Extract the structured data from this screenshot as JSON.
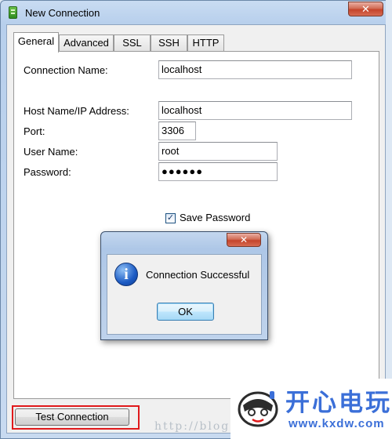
{
  "window": {
    "title": "New Connection",
    "close_glyph": "✕"
  },
  "tabs": [
    {
      "label": "General",
      "active": true
    },
    {
      "label": "Advanced",
      "active": false
    },
    {
      "label": "SSL",
      "active": false
    },
    {
      "label": "SSH",
      "active": false
    },
    {
      "label": "HTTP",
      "active": false
    }
  ],
  "form": {
    "connection_name": {
      "label": "Connection Name:",
      "value": "localhost"
    },
    "host": {
      "label": "Host Name/IP Address:",
      "value": "localhost"
    },
    "port": {
      "label": "Port:",
      "value": "3306"
    },
    "user": {
      "label": "User Name:",
      "value": "root"
    },
    "password": {
      "label": "Password:",
      "masked": "●●●●●●"
    },
    "save_password": {
      "label": "Save Password",
      "checked": true,
      "check_glyph": "✓"
    }
  },
  "dialog": {
    "close_glyph": "✕",
    "icon": "info-icon",
    "icon_glyph": "i",
    "message": "Connection Successful",
    "ok_label": "OK"
  },
  "footer": {
    "test_button": "Test Connection",
    "watermark": "http://blog"
  },
  "logo": {
    "text_cn": "开心电玩",
    "url": "www.kxdw.com"
  },
  "colors": {
    "highlight": "#e0191b",
    "logo_blue": "#3b6fd8",
    "titlebar": "#b7cfec"
  }
}
